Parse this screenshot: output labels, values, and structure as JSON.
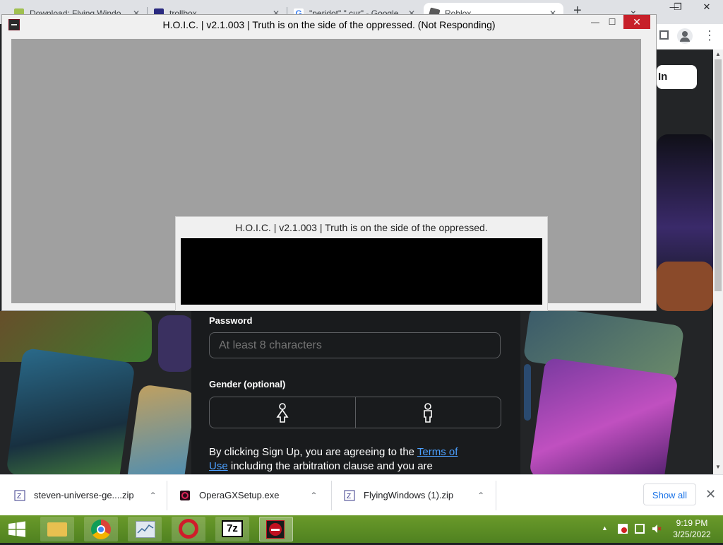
{
  "browser": {
    "tabs": [
      {
        "label": "Download: Flying Windo…",
        "icon": "download-favicon",
        "close": "✕"
      },
      {
        "label": "trollbox",
        "icon": "trollbox-favicon",
        "close": "✕"
      },
      {
        "label": "\"peridot\" \".cur\" - Google…",
        "icon": "google-icon",
        "close": "✕"
      },
      {
        "label": "Roblox",
        "icon": "roblox-icon",
        "close": "✕"
      }
    ],
    "new_tab": "+",
    "tab_search": "⌄",
    "window_controls": {
      "minimize": "—",
      "maximize": "❐",
      "close": "✕"
    },
    "toolbar": {
      "profile_icon": "profile-icon",
      "menu_icon": "⋮"
    }
  },
  "page": {
    "login_button_partial": "In",
    "password_label": "Password",
    "password_placeholder": "At least 8 characters",
    "gender_label": "Gender (optional)",
    "gender_female_icon": "female-icon",
    "gender_male_icon": "male-icon",
    "terms_prefix": "By clicking Sign Up, you are agreeing to the ",
    "terms_link_part1": "Terms of",
    "terms_link_part2": "Use",
    "terms_suffix": " including the arbitration clause and you are"
  },
  "hoic_main": {
    "title": "H.O.I.C. | v2.1.003 | Truth is on the side of the oppressed. (Not Responding)",
    "minimize": "—",
    "maximize": "☐",
    "close": "✕"
  },
  "hoic_popup": {
    "title": "H.O.I.C. | v2.1.003 | Truth is on the side of the oppressed."
  },
  "downloads": {
    "items": [
      {
        "name": "steven-universe-ge....zip",
        "icon": "zip-file-icon",
        "chevron": "⌃"
      },
      {
        "name": "OperaGXSetup.exe",
        "icon": "opera-gx-icon",
        "chevron": "⌃"
      },
      {
        "name": "FlyingWindows (1).zip",
        "icon": "zip-file-icon",
        "chevron": "⌃"
      }
    ],
    "show_all": "Show all",
    "close": "✕"
  },
  "taskbar": {
    "apps": [
      "windows-start",
      "file-explorer",
      "chrome",
      "system-monitor",
      "opera",
      "7zip",
      "hoic"
    ],
    "seven_zip_label": "7z",
    "tray_arrow": "▲",
    "time": "9:19 PM",
    "date": "3/25/2022"
  },
  "colors": {
    "taskbar": "#5a8b25",
    "hoic_close": "#c7202a",
    "roblox_dark": "#191b1d",
    "link": "#4ca0ff"
  }
}
